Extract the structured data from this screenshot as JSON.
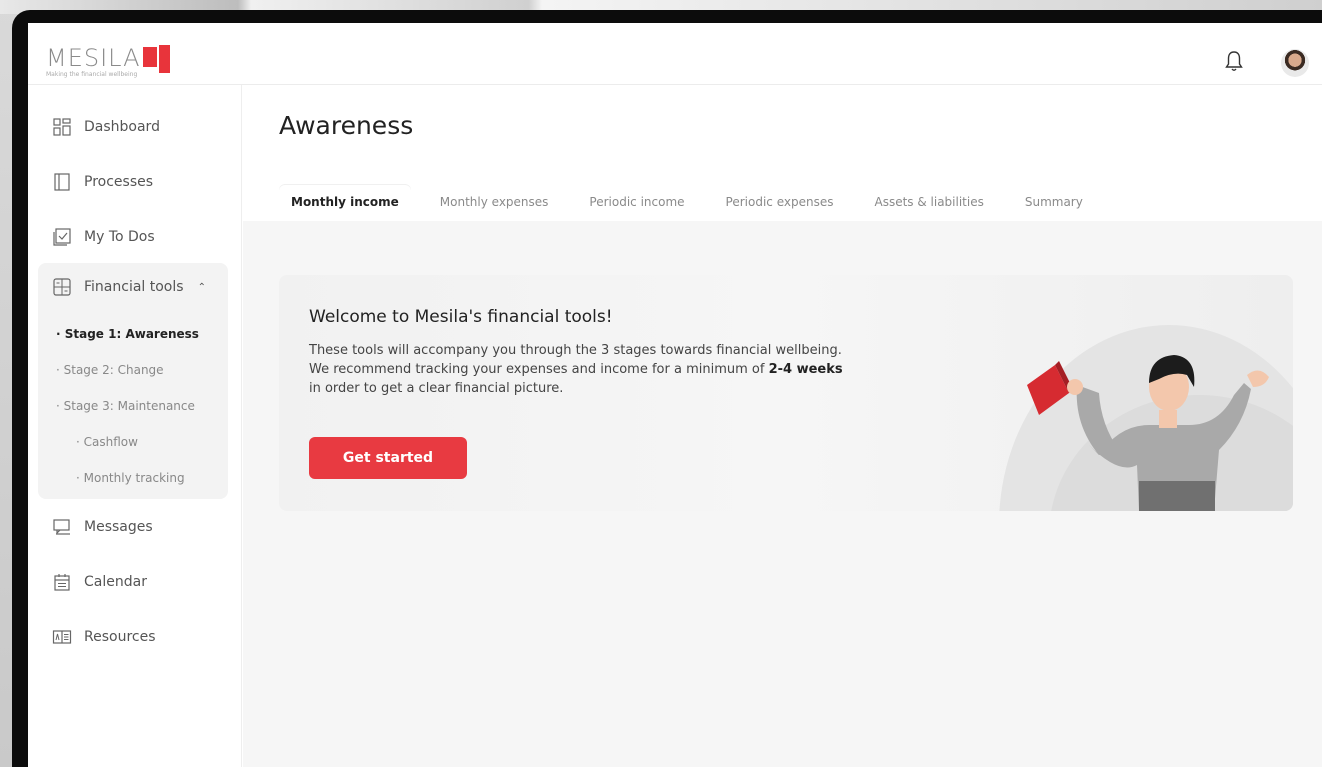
{
  "brand": {
    "name": "MESILA",
    "tagline": "Making the financial wellbeing",
    "accent": "#e8343b"
  },
  "header": {
    "bell_icon": "bell-icon",
    "avatar": "user-avatar"
  },
  "sidebar": {
    "items": [
      {
        "label": "Dashboard",
        "icon": "dashboard-icon"
      },
      {
        "label": "Processes",
        "icon": "processes-icon"
      },
      {
        "label": "My To Dos",
        "icon": "todo-icon"
      },
      {
        "label": "Financial tools",
        "icon": "calculator-icon"
      },
      {
        "label": "Messages",
        "icon": "messages-icon"
      },
      {
        "label": "Calendar",
        "icon": "calendar-icon"
      },
      {
        "label": "Resources",
        "icon": "resources-icon"
      }
    ],
    "financial_sub": [
      {
        "label": "· Stage 1: Awareness"
      },
      {
        "label": "· Stage 2: Change"
      },
      {
        "label": "· Stage 3: Maintenance"
      },
      {
        "label": "· Cashflow"
      },
      {
        "label": "· Monthly tracking"
      }
    ]
  },
  "main": {
    "title": "Awareness",
    "tabs": [
      {
        "label": "Monthly income"
      },
      {
        "label": "Monthly expenses"
      },
      {
        "label": "Periodic income"
      },
      {
        "label": "Periodic expenses"
      },
      {
        "label": "Assets & liabilities"
      },
      {
        "label": "Summary"
      }
    ],
    "card": {
      "title": "Welcome to Mesila's financial tools!",
      "line1": "These tools will accompany you through the 3 stages towards financial wellbeing.",
      "line2_pre": "We recommend tracking your expenses and income for a minimum of ",
      "line2_bold": "2-4 weeks",
      "line3": "in order to get a clear financial picture.",
      "cta": "Get started"
    }
  }
}
